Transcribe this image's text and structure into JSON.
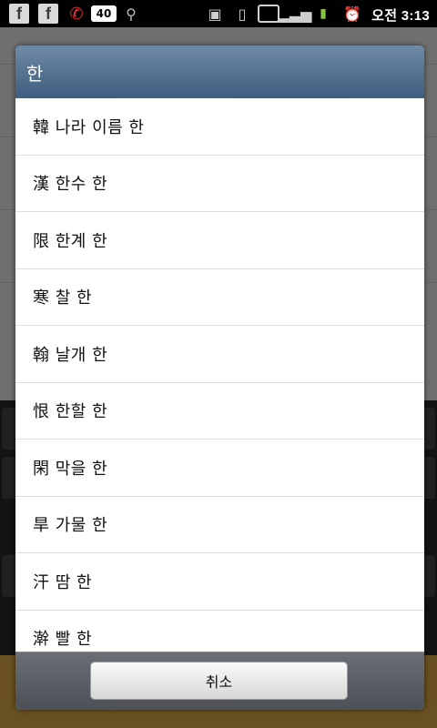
{
  "status_bar": {
    "icons": [
      {
        "name": "facebook-icon",
        "glyph": "f"
      },
      {
        "name": "facebook-icon",
        "glyph": "f"
      },
      {
        "name": "missed-call-icon",
        "glyph": "✆"
      },
      {
        "name": "notification-count-badge",
        "glyph": "40"
      },
      {
        "name": "usb-icon",
        "glyph": "⚲"
      }
    ],
    "time": "오전 3:13"
  },
  "dialog": {
    "title": "한",
    "items": [
      "韓 나라 이름 한",
      "漢 한수 한",
      "限 한계 한",
      "寒 찰 한",
      "翰 날개 한",
      "恨 한할 한",
      "閑 막을 한",
      "旱 가물 한",
      "汗 땀 한",
      "澣 빨 한"
    ],
    "cancel_label": "취소"
  },
  "colors": {
    "title_bar": "#4a6a8e",
    "footer": "#5a5e64",
    "divider": "#dcdcdc"
  }
}
